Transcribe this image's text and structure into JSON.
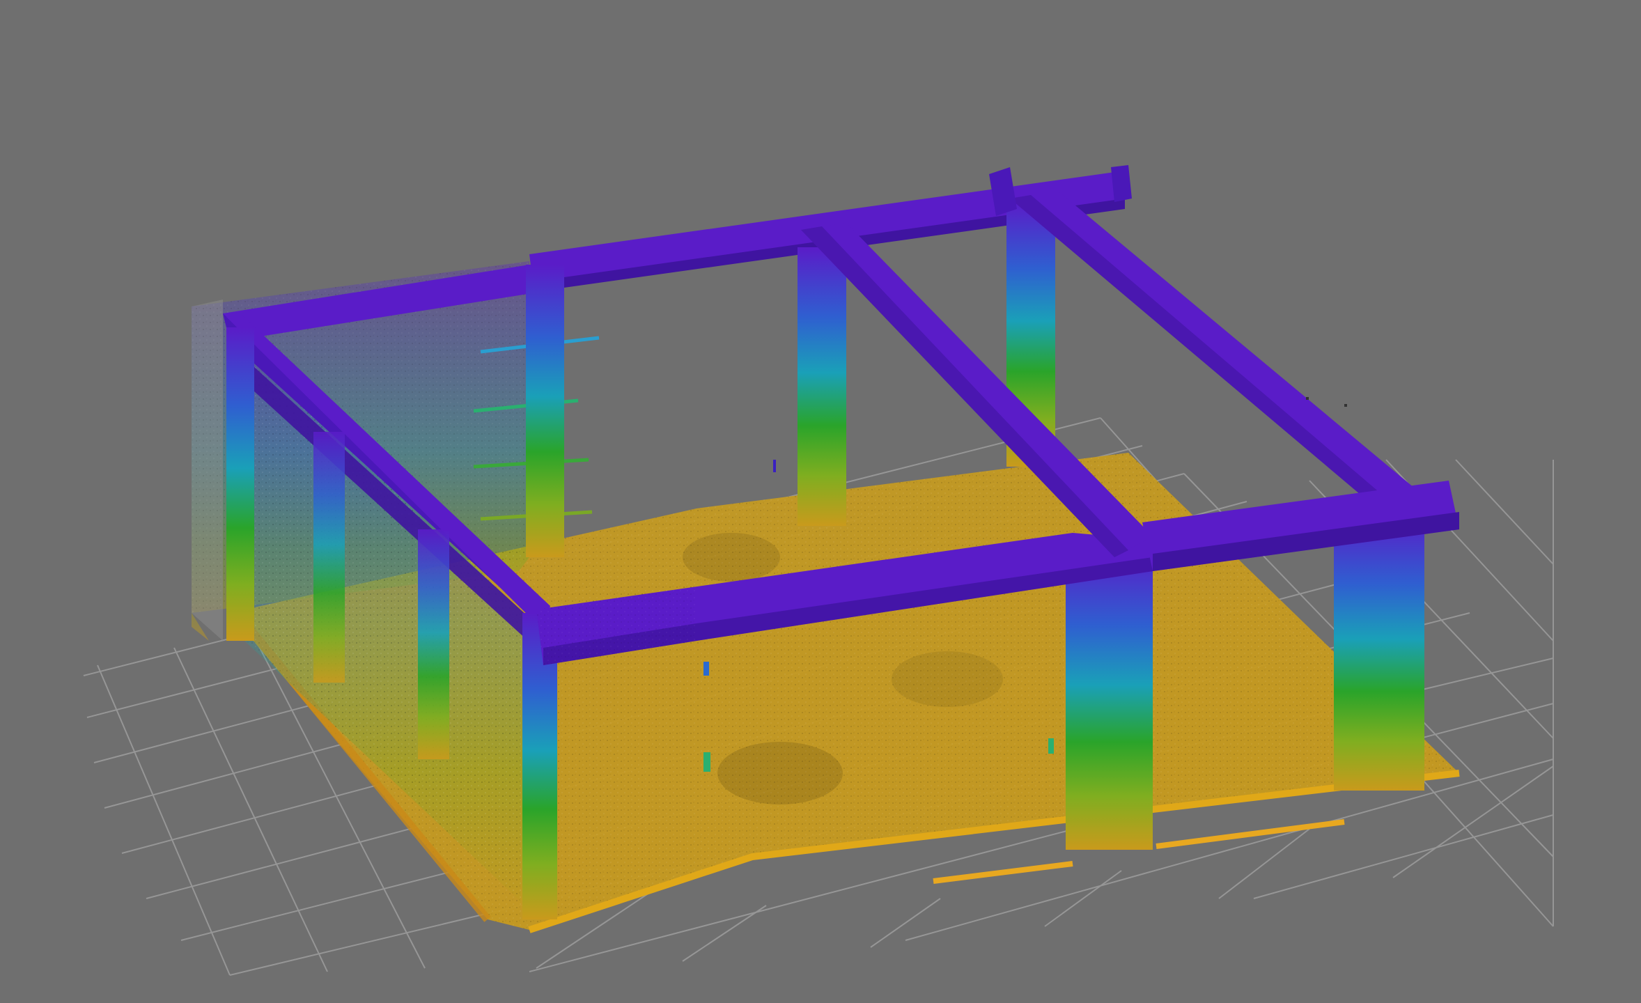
{
  "viewer": {
    "background_color": "#6f6f6f",
    "grid_color": "#9d9d9d",
    "colormap": {
      "name": "height",
      "low": "#c99a1c",
      "mid_low": "#2aa42a",
      "mid": "#1aa0b8",
      "high": "#5a1cc8"
    },
    "grid_visible": true
  }
}
